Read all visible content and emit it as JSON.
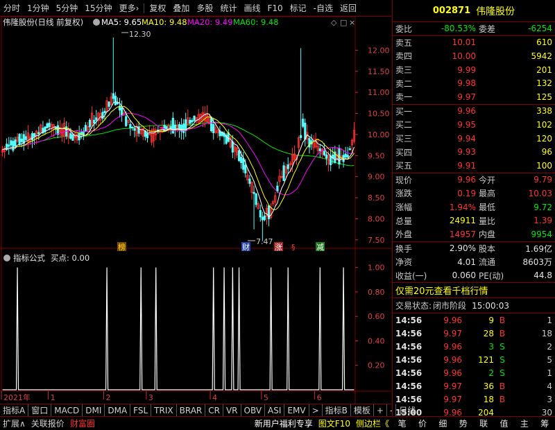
{
  "toolbar": {
    "items": [
      "分时",
      "1分钟",
      "5分钟",
      "15分钟",
      "更多›",
      "复权",
      "叠加",
      "多股",
      "统计",
      "画线",
      "F10",
      "标记",
      "-自选",
      "返回"
    ]
  },
  "main_header": {
    "title": "伟隆股份(日线 前复权)",
    "ma5_label": "MA5: 9.65",
    "ma10_label": "MA10: 9.48",
    "ma20_label": "MA20: 9.49",
    "ma60_label": "MA60: 9.48"
  },
  "indicator_header": {
    "title": "指标公式",
    "value": "买点: 0.00"
  },
  "annotations": {
    "high": "12.30",
    "low": "7.47",
    "bang": "榜",
    "cai": "财",
    "zhang": "涨",
    "s": "§",
    "jian": "减"
  },
  "colors": {
    "up": "#ff3232",
    "down": "#54ffff",
    "ma5": "#ffffff",
    "ma10": "#ffff00",
    "ma20": "#ff00ff",
    "ma60": "#00e600",
    "axis": "#800000",
    "grid": "#800000"
  },
  "chart_data": {
    "type": "candlestick",
    "price_axis": {
      "ticks": [
        "12.00",
        "11.50",
        "11.00",
        "10.50",
        "10.00",
        "9.50",
        "9.00",
        "8.50",
        "8.00",
        "7.50"
      ],
      "ylim": [
        7.3,
        12.5
      ]
    },
    "indicator_axis": {
      "ticks": [
        "1.00",
        "0.80",
        "0.60",
        "0.40",
        "0.20"
      ],
      "ylim": [
        0,
        1.1
      ]
    },
    "x_labels": [
      "2021年",
      "1",
      "2",
      "3",
      "4",
      "5",
      "6"
    ],
    "signal_days": [
      7,
      49,
      65,
      72,
      99,
      104,
      108,
      111,
      126,
      134,
      149,
      160
    ]
  },
  "quote": {
    "code": "002871",
    "name": "伟隆股份",
    "weibi_label": "委比",
    "weibi": "-80.53%",
    "weicha_label": "委差",
    "weicha": "-6254",
    "asks": [
      {
        "label": "卖五",
        "price": "10.01",
        "vol": "610"
      },
      {
        "label": "卖四",
        "price": "10.00",
        "vol": "5942"
      },
      {
        "label": "卖三",
        "price": "9.99",
        "vol": "201"
      },
      {
        "label": "卖二",
        "price": "9.98",
        "vol": "132"
      },
      {
        "label": "卖一",
        "price": "9.97",
        "vol": "125"
      }
    ],
    "bids": [
      {
        "label": "买一",
        "price": "9.96",
        "vol": "338"
      },
      {
        "label": "买二",
        "price": "9.95",
        "vol": "102"
      },
      {
        "label": "买三",
        "price": "9.94",
        "vol": "120"
      },
      {
        "label": "买四",
        "price": "9.93",
        "vol": "96"
      },
      {
        "label": "买五",
        "price": "9.91",
        "vol": "100"
      }
    ],
    "stats1": [
      {
        "l1": "现价",
        "v1": "9.96",
        "c1": "#ff3232",
        "l2": "今开",
        "v2": "9.79",
        "c2": "#ff3232"
      },
      {
        "l1": "涨跌",
        "v1": "0.19",
        "c1": "#ff3232",
        "l2": "最高",
        "v2": "10.03",
        "c2": "#ff3232"
      },
      {
        "l1": "涨幅",
        "v1": "1.94%",
        "c1": "#ff3232",
        "l2": "最低",
        "v2": "9.72",
        "c2": "#00e600"
      },
      {
        "l1": "总量",
        "v1": "24911",
        "c1": "#ffff00",
        "l2": "量比",
        "v2": "1.39",
        "c2": "#ff3232"
      },
      {
        "l1": "外盘",
        "v1": "14957",
        "c1": "#ff3232",
        "l2": "内盘",
        "v2": "9954",
        "c2": "#00e600"
      }
    ],
    "stats2": [
      {
        "l1": "换手",
        "v1": "2.90%",
        "l2": "股本",
        "v2": "1.69亿"
      },
      {
        "l1": "净资",
        "v1": "4.01",
        "l2": "流通",
        "v2": "8603万"
      },
      {
        "l1": "收益(一)",
        "v1": "0.060",
        "l2": "PE(动)",
        "v2": "44.8"
      }
    ],
    "promo": "仅需20元查看千档行情",
    "status_label": "交易状态:",
    "status_value": "闭市阶段",
    "status_time": "15:00:03",
    "ticks": [
      {
        "t": "14:56",
        "p": "9.96",
        "v": "9",
        "bs": "B",
        "n": "1",
        "vc": "#ffff00",
        "bc": "#ff3232"
      },
      {
        "t": "14:56",
        "p": "9.97",
        "v": "28",
        "bs": "B",
        "n": "18",
        "vc": "#ffff00",
        "bc": "#ff3232"
      },
      {
        "t": "14:56",
        "p": "9.96",
        "v": "3",
        "bs": "S",
        "n": "2",
        "vc": "#00e600",
        "bc": "#00e600"
      },
      {
        "t": "14:56",
        "p": "9.96",
        "v": "121",
        "bs": "S",
        "n": "5",
        "vc": "#ffff00",
        "bc": "#00e600"
      },
      {
        "t": "14:56",
        "p": "9.96",
        "v": "2",
        "bs": "S",
        "n": "1",
        "vc": "#00e600",
        "bc": "#00e600"
      },
      {
        "t": "14:56",
        "p": "9.97",
        "v": "36",
        "bs": "B",
        "n": "4",
        "vc": "#ffff00",
        "bc": "#ff3232"
      },
      {
        "t": "14:56",
        "p": "9.97",
        "v": "18",
        "bs": "B",
        "n": "3",
        "vc": "#ffff00",
        "bc": "#ff3232"
      },
      {
        "t": "15:00",
        "p": "9.96",
        "v": "204",
        "bs": "",
        "n": "30",
        "vc": "#ffff00",
        "bc": "#ff3232"
      }
    ]
  },
  "tabs": [
    "指标A",
    "窗口",
    "MACD",
    "DMI",
    "DMA",
    "FSL",
    "TRIX",
    "BRAR",
    "CR",
    "VR",
    "OBV",
    "ASI",
    "EMV",
    ">",
    "指标B",
    "模板",
    "+",
    "-",
    "日线"
  ],
  "bottom": {
    "left": [
      "扩展∧",
      "关联报价",
      "财富圈"
    ],
    "mid": [
      "新用户福利专享",
      "图文F10",
      "侧边栏《"
    ],
    "right": [
      "笔",
      "价",
      "细",
      "势",
      "联",
      "值",
      "主",
      "筹"
    ]
  }
}
